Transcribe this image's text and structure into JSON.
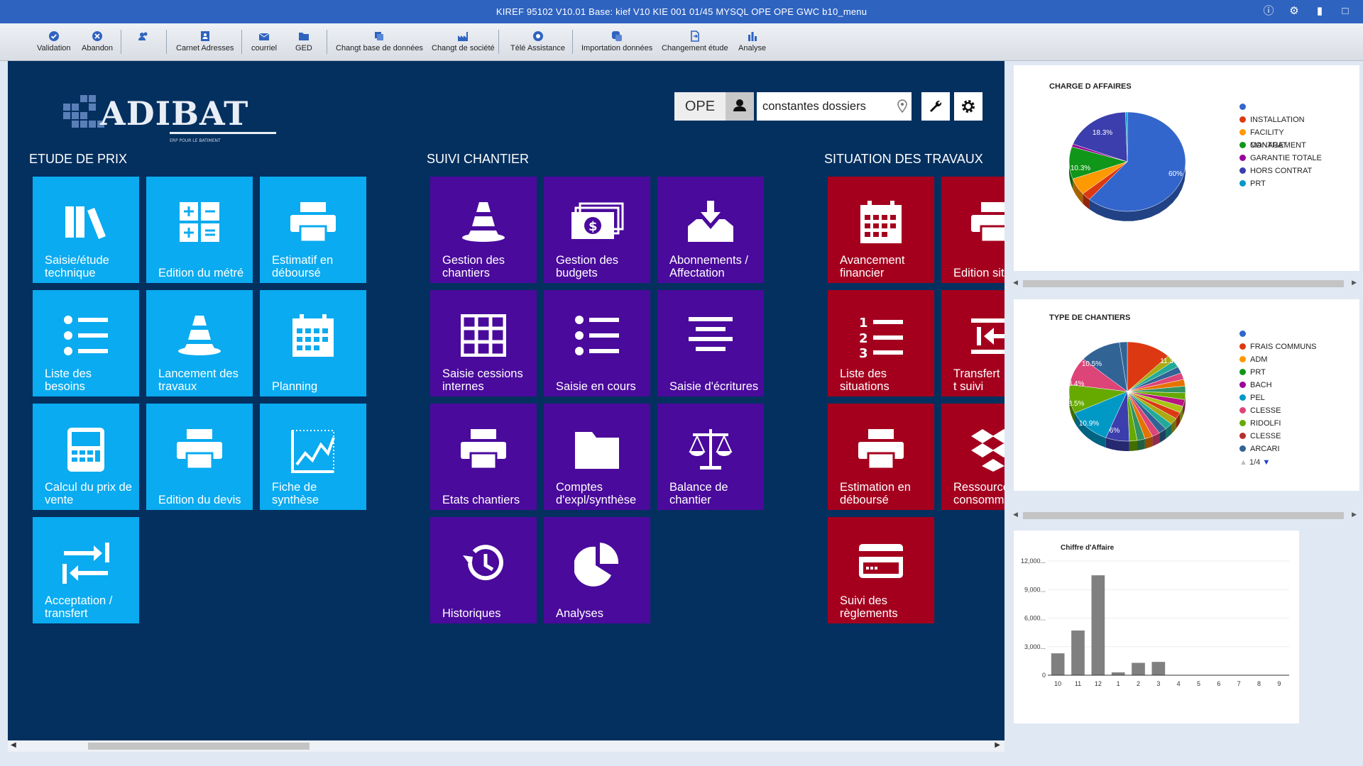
{
  "titlebar": {
    "title": "KIREF      95102 V10.01 Base: kief      V10 KIE 001 01/45 MYSQL OPE OPE GWC b10_menu",
    "icons": [
      "info-icon",
      "settings-icon",
      "bookmark-icon",
      "window-icon"
    ]
  },
  "toolbar": {
    "items": [
      {
        "label": "Validation",
        "icon": "check-icon"
      },
      {
        "label": "Abandon",
        "icon": "cancel-icon"
      },
      {
        "label": "",
        "icon": "users-icon"
      },
      {
        "label": "Carnet Adresses",
        "icon": "address-book-icon"
      },
      {
        "label": "courriel",
        "icon": "mail-icon"
      },
      {
        "label": "GED",
        "icon": "folder-icon"
      },
      {
        "label": "Changt base de données",
        "icon": "database-icon"
      },
      {
        "label": "Changt de société",
        "icon": "factory-icon"
      },
      {
        "label": "Télé Assistance",
        "icon": "support-icon"
      },
      {
        "label": "Importation données",
        "icon": "import-icon"
      },
      {
        "label": "Changement étude",
        "icon": "switch-icon"
      },
      {
        "label": "Analyse",
        "icon": "bar-chart-icon"
      }
    ]
  },
  "logo": {
    "text": "ADIBAT",
    "tagline": "ERP POUR LE BATIMENT"
  },
  "header": {
    "ope": "OPE",
    "search_value": "constantes dossiers"
  },
  "sections": [
    {
      "title": "ETUDE DE PRIX"
    },
    {
      "title": "SUIVI CHANTIER"
    },
    {
      "title": "SITUATION DES TRAVAUX"
    }
  ],
  "tiles": [
    {
      "label": "Saisie/étude technique",
      "icon": "books-icon"
    },
    {
      "label": "Edition du métré",
      "icon": "calculator-icon"
    },
    {
      "label": "Estimatif en déboursé",
      "icon": "printer-icon"
    },
    {
      "label": "Liste des besoins",
      "icon": "list-icon"
    },
    {
      "label": "Lancement des travaux",
      "icon": "traffic-cone-icon"
    },
    {
      "label": "Planning",
      "icon": "calendar-icon"
    },
    {
      "label": "Calcul du prix de vente",
      "icon": "calculator-icon"
    },
    {
      "label": "Edition du devis",
      "icon": "printer-icon"
    },
    {
      "label": "Fiche de synthèse",
      "icon": "line-chart-icon"
    },
    {
      "label": "Acceptation / transfert",
      "icon": "transfer-icon"
    },
    {
      "label": "Gestion des chantiers",
      "icon": "traffic-cone-icon"
    },
    {
      "label": "Gestion des budgets",
      "icon": "money-icon"
    },
    {
      "label": "Abonnements / Affectation",
      "icon": "inbox-download-icon"
    },
    {
      "label": "Saisie cessions internes",
      "icon": "grid-icon"
    },
    {
      "label": "Saisie en cours",
      "icon": "list-icon"
    },
    {
      "label": "Saisie d'écritures",
      "icon": "align-icon"
    },
    {
      "label": "Etats chantiers",
      "icon": "printer-icon"
    },
    {
      "label": "Comptes d'expl/synthèse",
      "icon": "folder-icon"
    },
    {
      "label": "Balance de chantier",
      "icon": "balance-icon"
    },
    {
      "label": "Historiques",
      "icon": "history-icon"
    },
    {
      "label": "Analyses",
      "icon": "pie-icon"
    },
    {
      "label": "Avancement financier",
      "icon": "calendar-icon"
    },
    {
      "label": "Edition sit",
      "icon": "printer-icon"
    },
    {
      "label": "Liste des situations",
      "icon": "numbered-list-icon"
    },
    {
      "label": "Transfert t suivi",
      "icon": "arrow-left-bar-icon"
    },
    {
      "label": "Estimation en déboursé",
      "icon": "printer-icon"
    },
    {
      "label": "Ressource consomm",
      "icon": "dropbox-icon"
    },
    {
      "label": "Suivi des règlements",
      "icon": "credit-card-icon"
    }
  ],
  "colors": {
    "blue": "#0aabf0",
    "purple": "#4a0a9c",
    "red": "#a4001e",
    "background": "#04305f"
  },
  "chart_data": [
    {
      "type": "pie",
      "title": "CHARGE D AFFAIRES",
      "legend": [
        "",
        "INSTALLATION",
        "FACILITY MANAGEMENT",
        "CONTRAT",
        "GARANTIE TOTALE",
        "HORS CONTRAT",
        "PRT"
      ],
      "legend_colors": [
        "#3366cc",
        "#dc3912",
        "#ff9900",
        "#109618",
        "#990099",
        "#3b3eac",
        "#0099c6"
      ],
      "slice_labels": [
        "60%",
        "18.3%",
        "10.3%"
      ],
      "values": [
        60,
        2.5,
        5.4,
        10.3,
        0.9,
        18.3,
        0.5
      ]
    },
    {
      "type": "pie",
      "title": "TYPE DE CHANTIERS",
      "legend": [
        "",
        "FRAIS COMMUNS",
        "ADM",
        "PRT",
        "BACH",
        "PEL",
        "CLESSE",
        "RIDOLFI",
        "CLESSE",
        "ARCARI"
      ],
      "legend_colors": [
        "#3366cc",
        "#dc3912",
        "#ff9900",
        "#109618",
        "#990099",
        "#0099c6",
        "#dd4477",
        "#66aa00",
        "#b82e2e",
        "#316395"
      ],
      "slice_labels": [
        "11.3%",
        "10.5%",
        "8.4%",
        "8.5%",
        "10.9%",
        "6%"
      ],
      "pager": "1/4"
    },
    {
      "type": "bar",
      "title": "Chiffre d'Affaire",
      "categories": [
        "10",
        "11",
        "12",
        "1",
        "2",
        "3",
        "4",
        "5",
        "6",
        "7",
        "8",
        "9"
      ],
      "values": [
        2300,
        4700,
        10500,
        300,
        1300,
        1400,
        0,
        0,
        0,
        0,
        0,
        0
      ],
      "y_ticks": [
        "12,000...",
        "9,000...",
        "6,000...",
        "3,000...",
        "0"
      ],
      "ylim": [
        0,
        12000
      ]
    }
  ]
}
